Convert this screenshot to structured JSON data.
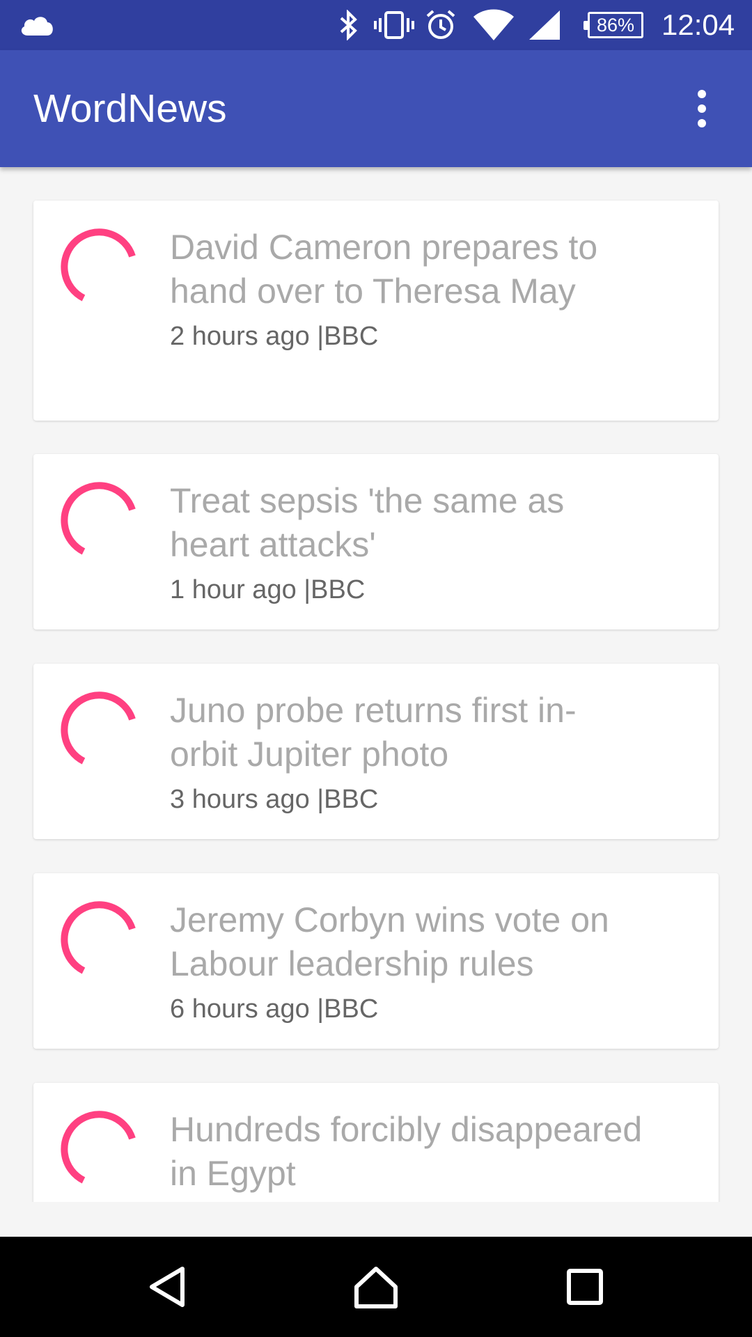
{
  "status_bar": {
    "battery_percent": "86%",
    "time": "12:04",
    "icons": [
      "cloud-icon",
      "bluetooth-icon",
      "vibrate-icon",
      "alarm-icon",
      "wifi-icon",
      "signal-icon",
      "battery-icon"
    ]
  },
  "app_bar": {
    "title": "WordNews",
    "menu_icon": "more-vert-icon"
  },
  "articles": [
    {
      "title": "David Cameron prepares to hand over to Theresa May",
      "time": "2 hours ago",
      "source": "BBC"
    },
    {
      "title": "Treat sepsis 'the same as heart attacks'",
      "time": "1 hour ago",
      "source": "BBC"
    },
    {
      "title": "Juno probe returns first in-orbit Jupiter photo",
      "time": "3 hours ago",
      "source": "BBC"
    },
    {
      "title": "Jeremy Corbyn wins vote on Labour leadership rules",
      "time": "6 hours ago",
      "source": "BBC"
    },
    {
      "title": "Hundreds forcibly disappeared in Egypt",
      "time": "",
      "source": ""
    }
  ],
  "meta_separator": "|",
  "colors": {
    "status_bar": "#303f9f",
    "app_bar": "#3f51b5",
    "spinner": "#ff4081",
    "headline": "#a9a9a9"
  },
  "nav_bar": {
    "icons": [
      "back-icon",
      "home-icon",
      "recents-icon"
    ]
  }
}
